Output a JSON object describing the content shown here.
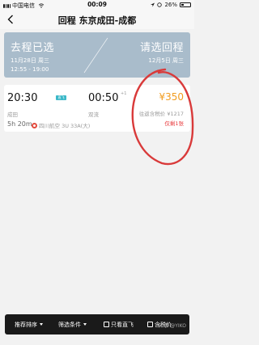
{
  "status_bar": {
    "carrier": "中国电信",
    "time": "00:09",
    "battery": "26%"
  },
  "header": {
    "title": "回程 东京成田-成都"
  },
  "trip": {
    "outbound": {
      "heading": "去程已选",
      "date": "11月28日 周三",
      "time": "12:55 - 19:00"
    },
    "return": {
      "heading": "请选回程",
      "date": "12月5日 周三"
    }
  },
  "flight": {
    "departure_time": "20:30",
    "departure_airport": "成田",
    "badge": "直飞",
    "arrival_time": "00:50",
    "arrival_plus": "+1",
    "arrival_airport": "双流",
    "duration": "5h 20m",
    "airline": "四川航空 3U",
    "aircraft": "33A(大)",
    "price": "¥350",
    "tax_price": "往返含税价 ¥1217",
    "seats_left": "仅剩1张"
  },
  "annotation": {
    "color": "#d93a3a"
  },
  "filter_bar": {
    "sort_label": "推荐排序",
    "filter_label": "筛选条件",
    "direct_label": "只看直飞",
    "tax_label": "含税价"
  },
  "watermark": "知乎 @YIKO",
  "colors": {
    "accent_price": "#f29c1f",
    "trip_panel": "#a9bccb",
    "seat_alert": "#e8373a"
  }
}
